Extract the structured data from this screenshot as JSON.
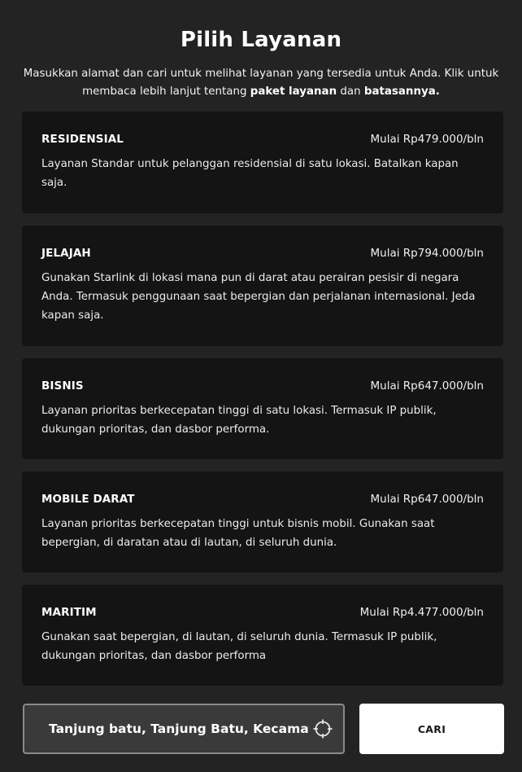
{
  "header": {
    "title": "Pilih Layanan",
    "intro_before": "Masukkan alamat dan cari untuk melihat layanan yang tersedia untuk Anda. Klik untuk membaca lebih lanjut tentang ",
    "intro_link_plans": "paket layanan",
    "intro_mid": " dan ",
    "intro_link_limits": "batasannya."
  },
  "plans": [
    {
      "name": "RESIDENSIAL",
      "price": "Mulai Rp479.000/bln",
      "description": "Layanan Standar untuk pelanggan residensial di satu lokasi. Batalkan kapan saja."
    },
    {
      "name": "JELAJAH",
      "price": "Mulai Rp794.000/bln",
      "description": "Gunakan Starlink di lokasi mana pun di darat atau perairan pesisir di negara Anda. Termasuk penggunaan saat bepergian dan perjalanan internasional. Jeda kapan saja."
    },
    {
      "name": "BISNIS",
      "price": "Mulai Rp647.000/bln",
      "description": "Layanan prioritas berkecepatan tinggi di satu lokasi. Termasuk IP publik, dukungan prioritas, dan dasbor performa."
    },
    {
      "name": "MOBILE DARAT",
      "price": "Mulai Rp647.000/bln",
      "description": "Layanan prioritas berkecepatan tinggi untuk bisnis mobil. Gunakan saat bepergian, di daratan atau di lautan, di seluruh dunia."
    },
    {
      "name": "MARITIM",
      "price": "Mulai Rp4.477.000/bln",
      "description": "Gunakan saat bepergian, di lautan, di seluruh dunia. Termasuk IP publik, dukungan prioritas, dan dasbor performa"
    }
  ],
  "search": {
    "value": "Tanjung batu, Tanjung Batu, Kecamatan",
    "icon": "locate-crosshair-icon"
  },
  "actions": {
    "search_label": "CARI"
  }
}
